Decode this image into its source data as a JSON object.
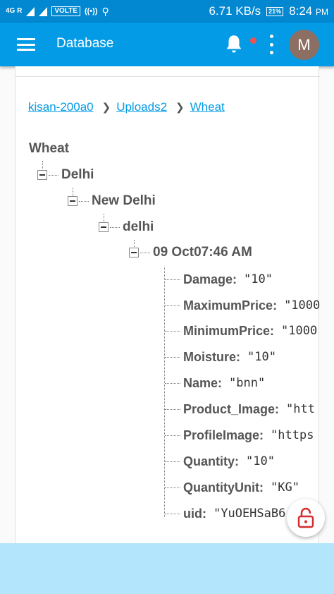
{
  "status_bar": {
    "network": "4G R",
    "volte": "VOLTE",
    "speed": "6.71 KB/s",
    "battery": "21%",
    "time": "8:24",
    "ampm": "PM"
  },
  "app_bar": {
    "title": "Database",
    "avatar_initial": "M",
    "icons": [
      "menu-icon",
      "bell-icon",
      "more-vert-icon"
    ],
    "accent": "#039be5",
    "notification_dot": "#ef5350"
  },
  "breadcrumb": [
    {
      "label": "kisan-200a0"
    },
    {
      "label": "Uploads2"
    },
    {
      "label": "Wheat"
    }
  ],
  "tree": {
    "root": "Wheat",
    "nodes": [
      {
        "label": "Delhi"
      },
      {
        "label": "New Delhi"
      },
      {
        "label": "delhi"
      },
      {
        "label": "09 Oct07:46 AM"
      }
    ],
    "fields": [
      {
        "key": "Damage",
        "value": "\"10\""
      },
      {
        "key": "MaximumPrice",
        "value": "\"1000"
      },
      {
        "key": "MinimumPrice",
        "value": "\"1000"
      },
      {
        "key": "Moisture",
        "value": "\"10\""
      },
      {
        "key": "Name",
        "value": "\"bnn\""
      },
      {
        "key": "Product_Image",
        "value": "\"htt"
      },
      {
        "key": "ProfileImage",
        "value": "\"https"
      },
      {
        "key": "Quantity",
        "value": "\"10\""
      },
      {
        "key": "QuantityUnit",
        "value": "\"KG\""
      },
      {
        "key": "uid",
        "value": "\"YuOEHSaB6"
      }
    ]
  },
  "fab": {
    "icon": "lock-open-icon",
    "color": "#d32f2f"
  }
}
